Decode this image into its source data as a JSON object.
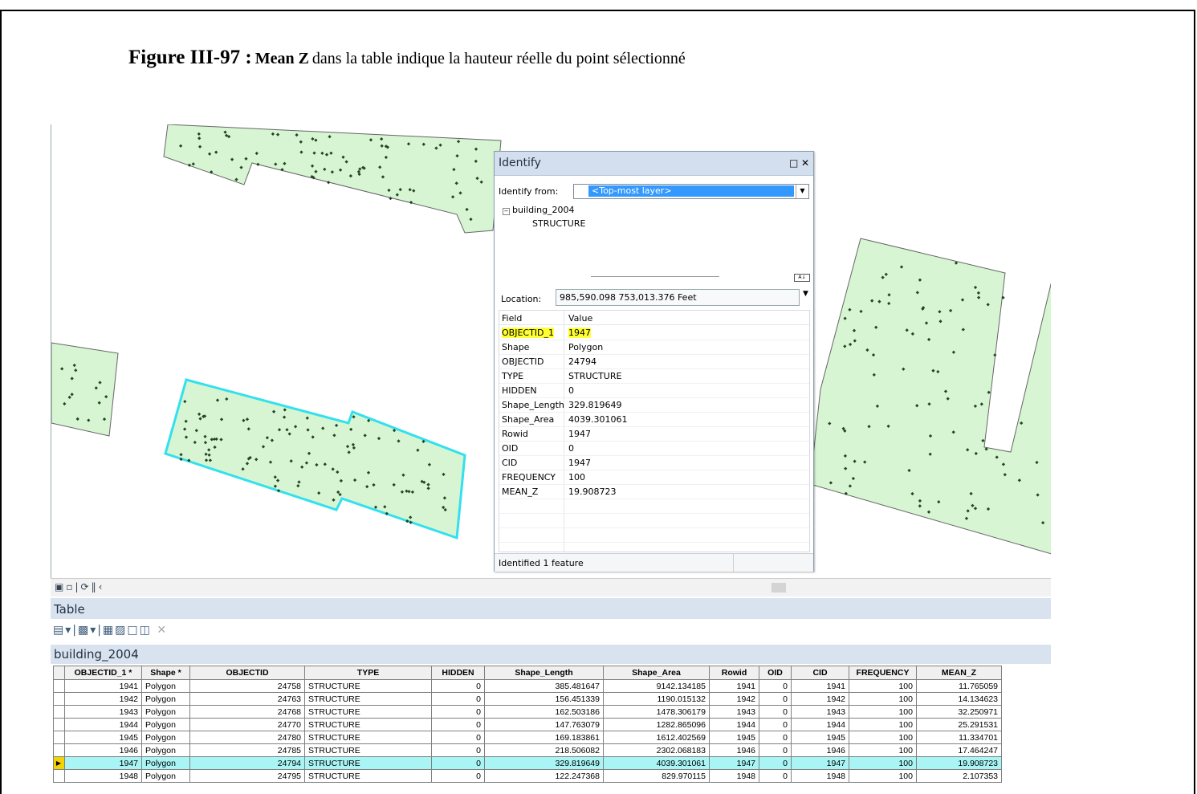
{
  "caption": {
    "label": "Figure III-97 :",
    "bold": "Mean Z",
    "text": "dans la table indique la hauteur réelle du point sélectionné"
  },
  "identify": {
    "title": "Identify",
    "from_label": "Identify from:",
    "from_value": "<Top-most layer>",
    "tree_layer": "building_2004",
    "tree_feature": "STRUCTURE",
    "location_label": "Location:",
    "location_value": "985,590.098  753,013.376 Feet",
    "col_field": "Field",
    "col_value": "Value",
    "rows": [
      {
        "field": "OBJECTID_1",
        "value": "1947"
      },
      {
        "field": "Shape",
        "value": "Polygon"
      },
      {
        "field": "OBJECTID",
        "value": "24794"
      },
      {
        "field": "TYPE",
        "value": "STRUCTURE"
      },
      {
        "field": "HIDDEN",
        "value": "0"
      },
      {
        "field": "Shape_Length",
        "value": "329.819649"
      },
      {
        "field": "Shape_Area",
        "value": "4039.301061"
      },
      {
        "field": "Rowid",
        "value": "1947"
      },
      {
        "field": "OID",
        "value": "0"
      },
      {
        "field": "CID",
        "value": "1947"
      },
      {
        "field": "FREQUENCY",
        "value": "100"
      },
      {
        "field": "MEAN_Z",
        "value": "19.908723"
      }
    ],
    "status": "Identified 1 feature"
  },
  "table": {
    "title": "Table",
    "layer": "building_2004",
    "columns": [
      "OBJECTID_1 *",
      "Shape *",
      "OBJECTID",
      "TYPE",
      "HIDDEN",
      "Shape_Length",
      "Shape_Area",
      "Rowid",
      "OID",
      "CID",
      "FREQUENCY",
      "MEAN_Z"
    ],
    "rows": [
      [
        "1941",
        "Polygon",
        "24758",
        "STRUCTURE",
        "0",
        "385.481647",
        "9142.134185",
        "1941",
        "0",
        "1941",
        "100",
        "11.765059"
      ],
      [
        "1942",
        "Polygon",
        "24763",
        "STRUCTURE",
        "0",
        "156.451339",
        "1190.015132",
        "1942",
        "0",
        "1942",
        "100",
        "14.134623"
      ],
      [
        "1943",
        "Polygon",
        "24768",
        "STRUCTURE",
        "0",
        "162.503186",
        "1478.306179",
        "1943",
        "0",
        "1943",
        "100",
        "32.250971"
      ],
      [
        "1944",
        "Polygon",
        "24770",
        "STRUCTURE",
        "0",
        "147.763079",
        "1282.865096",
        "1944",
        "0",
        "1944",
        "100",
        "25.291531"
      ],
      [
        "1945",
        "Polygon",
        "24780",
        "STRUCTURE",
        "0",
        "169.183861",
        "1612.402569",
        "1945",
        "0",
        "1945",
        "100",
        "11.334701"
      ],
      [
        "1946",
        "Polygon",
        "24785",
        "STRUCTURE",
        "0",
        "218.506082",
        "2302.068183",
        "1946",
        "0",
        "1946",
        "100",
        "17.464247"
      ],
      [
        "1947",
        "Polygon",
        "24794",
        "STRUCTURE",
        "0",
        "329.819649",
        "4039.301061",
        "1947",
        "0",
        "1947",
        "100",
        "19.908723"
      ],
      [
        "1948",
        "Polygon",
        "24795",
        "STRUCTURE",
        "0",
        "122.247368",
        "829.970115",
        "1948",
        "0",
        "1948",
        "100",
        "2.107353"
      ]
    ],
    "selected_row": 6
  },
  "colors": {
    "polygon_fill": "#d7f5d3",
    "polygon_stroke": "#555555",
    "selection": "#33e0ee",
    "highlight": "#ffff33",
    "selected_row": "#a9f5f5"
  }
}
